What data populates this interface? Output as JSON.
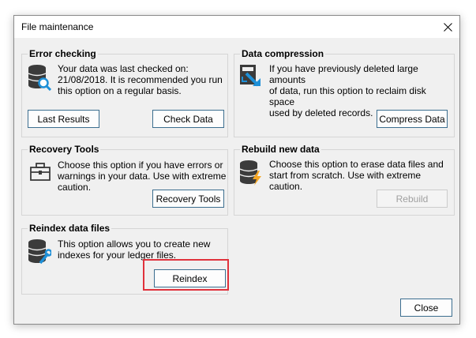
{
  "window": {
    "title": "File maintenance",
    "close_glyph": "✕"
  },
  "groups": {
    "error_checking": {
      "title": "Error checking",
      "text": "Your data was last checked on:\n21/08/2018.  It is recommended you run\nthis option on a regular basis.",
      "icon": "database-search-icon",
      "buttons": {
        "last_results": "Last Results",
        "check_data": "Check Data"
      }
    },
    "data_compression": {
      "title": "Data compression",
      "text": "If you have previously deleted large amounts\nof data, run this option to reclaim disk space\nused by deleted records.",
      "icon": "compress-icon",
      "buttons": {
        "compress": "Compress Data"
      }
    },
    "recovery_tools": {
      "title": "Recovery Tools",
      "text": "Choose this option if you have errors or\nwarnings in your data. Use with extreme\ncaution.",
      "icon": "toolbox-icon",
      "buttons": {
        "recovery": "Recovery Tools"
      }
    },
    "rebuild": {
      "title": "Rebuild new data",
      "text": "Choose this option to erase data files and\nstart from scratch. Use with extreme caution.",
      "icon": "database-lightning-icon",
      "buttons": {
        "rebuild": "Rebuild"
      }
    },
    "reindex": {
      "title": "Reindex data files",
      "text": "This option allows you to create new\nindexes for your ledger files.",
      "icon": "database-wrench-icon",
      "buttons": {
        "reindex": "Reindex"
      }
    }
  },
  "footer": {
    "close": "Close"
  },
  "colors": {
    "highlight": "#e0323c",
    "accent": "#0078d7",
    "db_dark": "#3b3b3b",
    "blue": "#1e90d8",
    "orange": "#f5a623"
  }
}
